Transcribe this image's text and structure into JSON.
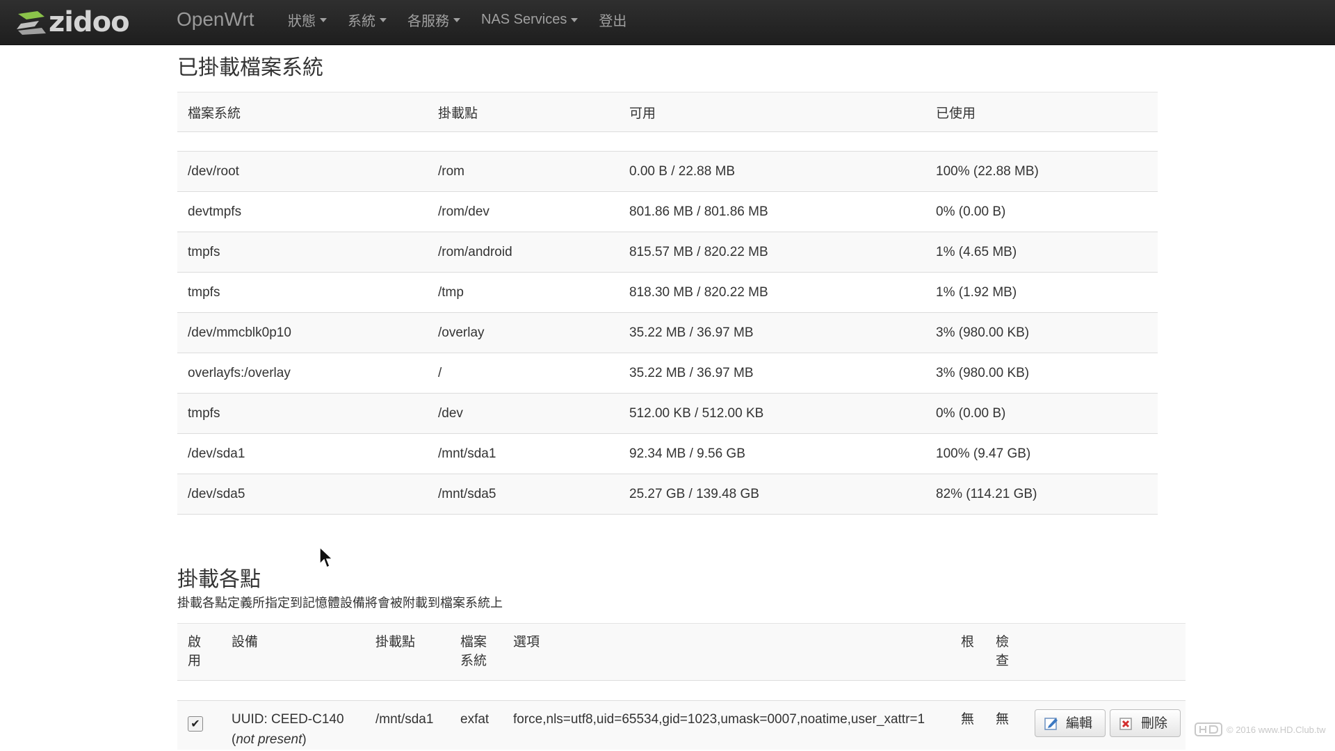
{
  "navbar": {
    "logo_text": "zidoo",
    "brand": "OpenWrt",
    "menu": [
      "狀態",
      "系統",
      "各服務",
      "NAS Services",
      "登出"
    ]
  },
  "mounted": {
    "title": "已掛載檔案系統",
    "headers": [
      "檔案系統",
      "掛載點",
      "可用",
      "已使用"
    ],
    "rows": [
      [
        "/dev/root",
        "/rom",
        "0.00 B / 22.88 MB",
        "100% (22.88 MB)"
      ],
      [
        "devtmpfs",
        "/rom/dev",
        "801.86 MB / 801.86 MB",
        "0% (0.00 B)"
      ],
      [
        "tmpfs",
        "/rom/android",
        "815.57 MB / 820.22 MB",
        "1% (4.65 MB)"
      ],
      [
        "tmpfs",
        "/tmp",
        "818.30 MB / 820.22 MB",
        "1% (1.92 MB)"
      ],
      [
        "/dev/mmcblk0p10",
        "/overlay",
        "35.22 MB / 36.97 MB",
        "3% (980.00 KB)"
      ],
      [
        "overlayfs:/overlay",
        "/",
        "35.22 MB / 36.97 MB",
        "3% (980.00 KB)"
      ],
      [
        "tmpfs",
        "/dev",
        "512.00 KB / 512.00 KB",
        "0% (0.00 B)"
      ],
      [
        "/dev/sda1",
        "/mnt/sda1",
        "92.34 MB / 9.56 GB",
        "100% (9.47 GB)"
      ],
      [
        "/dev/sda5",
        "/mnt/sda5",
        "25.27 GB / 139.48 GB",
        "82% (114.21 GB)"
      ]
    ]
  },
  "mountpoints": {
    "title": "掛載各點",
    "description": "掛載各點定義所指定到記憶體設備將會被附載到檔案系統上",
    "headers": {
      "enable_1": "啟",
      "enable_2": "用",
      "device": "設備",
      "mountpoint": "掛載點",
      "fs_1": "檔案",
      "fs_2": "系統",
      "options": "選項",
      "root": "根",
      "check_1": "檢",
      "check_2": "查"
    },
    "row": {
      "enabled": true,
      "device": "UUID: CEED-C140",
      "device_note": "not present",
      "mountpoint": "/mnt/sda1",
      "fs": "exfat",
      "options": "force,nls=utf8,uid=65534,gid=1023,umask=0007,noatime,user_xattr=1",
      "root": "無",
      "check": "無",
      "edit_label": "編輯",
      "delete_label": "刪除"
    }
  },
  "watermark": "© 2016 www.HD.Club.tw"
}
